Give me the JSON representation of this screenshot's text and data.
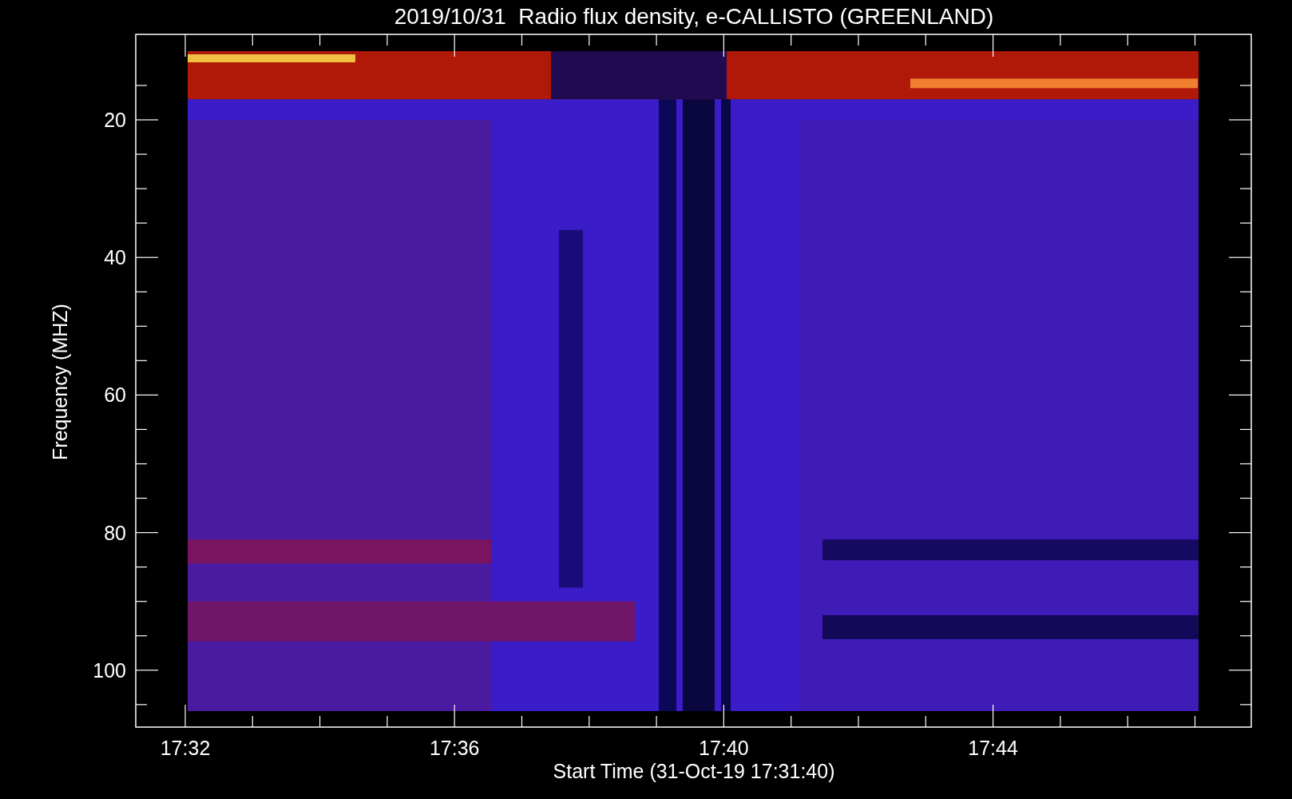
{
  "plot": {
    "title": "2019/10/31  Radio flux density, e-CALLISTO (GREENLAND)",
    "xlabel": "Start Time (31-Oct-19 17:31:40)",
    "ylabel": "Frequency (MHZ)",
    "xticks": [
      "17:32",
      "17:36",
      "17:40",
      "17:44"
    ],
    "yticks": [
      "20",
      "40",
      "60",
      "80",
      "100"
    ]
  }
}
